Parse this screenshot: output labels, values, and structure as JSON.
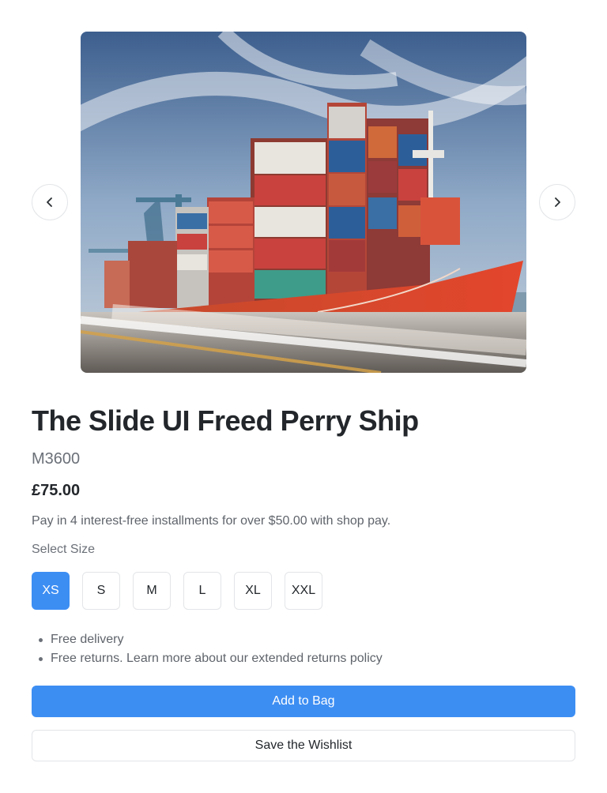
{
  "product": {
    "image_alt": "Container ship",
    "title": "The Slide UI Freed Perry Ship",
    "sku": "M3600",
    "price": "£75.00",
    "pay_note": "Pay in 4 interest-free installments for over $50.00 with shop pay.",
    "size_label": "Select Size",
    "sizes": [
      "XS",
      "S",
      "M",
      "L",
      "XL",
      "XXL"
    ],
    "selected_size": "XS",
    "benefits": [
      "Free delivery",
      "Free returns. Learn more about our extended returns policy"
    ]
  },
  "carousel": {
    "prev_icon": "chevron-left-icon",
    "next_icon": "chevron-right-icon"
  },
  "actions": {
    "add_label": "Add to Bag",
    "wishlist_label": "Save the Wishlist"
  },
  "colors": {
    "accent": "#3d8ef3",
    "border": "#e3e5e8",
    "text": "#23272b",
    "muted": "#6b7078"
  }
}
